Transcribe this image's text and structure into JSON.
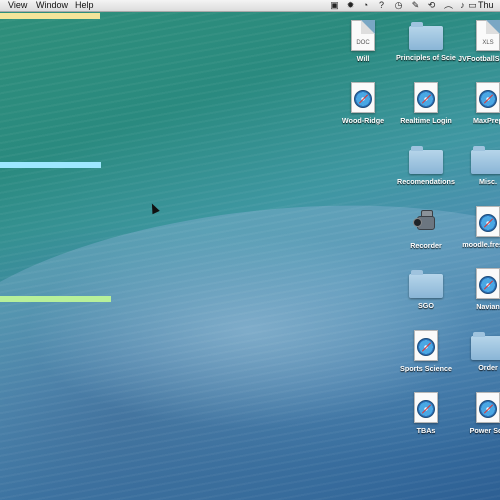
{
  "menubar": {
    "items": [
      "View",
      "Window",
      "Help"
    ],
    "clock": "Thu",
    "status_icons": [
      "adobe-icon",
      "gear-sync-icon",
      "timer-icon",
      "help-icon",
      "activity-icon",
      "script-icon",
      "bluetooth-icon",
      "time-machine-icon",
      "wifi-icon",
      "volume-icon",
      "battery-icon",
      "flag-icon"
    ]
  },
  "accent_bars": [
    {
      "name": "yellow-bar",
      "color": "#f4e59a"
    },
    {
      "name": "cyan-bar",
      "color": "#9ee8ff"
    },
    {
      "name": "green-bar",
      "color": "#b7f09a"
    }
  ],
  "desktop_items": [
    {
      "label": "Will",
      "type": "doc",
      "tag": "DOC"
    },
    {
      "label": "Principles of Science",
      "type": "folder"
    },
    {
      "label": "JVFootballS nReport2",
      "type": "doc",
      "tag": "XLS"
    },
    {
      "label": "Wood-Ridge",
      "type": "webloc"
    },
    {
      "label": "Realtime Login",
      "type": "webloc"
    },
    {
      "label": "MaxPrep",
      "type": "webloc"
    },
    {
      "label": "Recomendations",
      "type": "folder"
    },
    {
      "label": "Misc.",
      "type": "folder"
    },
    {
      "label": "Recorder",
      "type": "app"
    },
    {
      "label": "moodle.fres du",
      "type": "webloc"
    },
    {
      "label": "SGO",
      "type": "folder"
    },
    {
      "label": "Navian",
      "type": "webloc"
    },
    {
      "label": "Sports Science",
      "type": "webloc"
    },
    {
      "label": "Order",
      "type": "folder"
    },
    {
      "label": "TBAs",
      "type": "webloc"
    },
    {
      "label": "Power Sch",
      "type": "webloc"
    }
  ]
}
